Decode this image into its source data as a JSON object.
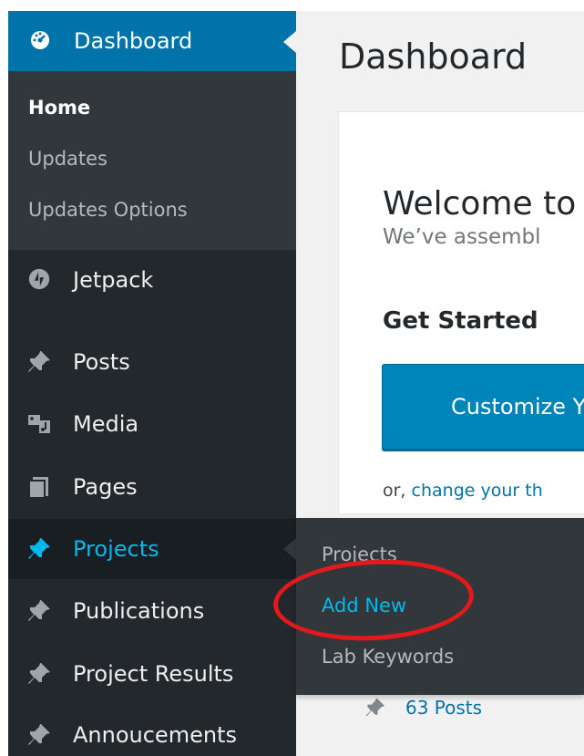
{
  "sidebar": {
    "dashboard": {
      "label": "Dashboard",
      "icon": "dashboard-gauge-icon"
    },
    "dashboard_submenu": [
      {
        "label": "Home",
        "current": true
      },
      {
        "label": "Updates",
        "current": false
      },
      {
        "label": "Updates Options",
        "current": false
      }
    ],
    "items": [
      {
        "label": "Jetpack",
        "icon": "jetpack-icon"
      },
      {
        "label": "Posts",
        "icon": "pushpin-icon"
      },
      {
        "label": "Media",
        "icon": "media-icon"
      },
      {
        "label": "Pages",
        "icon": "pages-icon"
      },
      {
        "label": "Projects",
        "icon": "pushpin-icon",
        "active": true
      },
      {
        "label": "Publications",
        "icon": "pushpin-icon"
      },
      {
        "label": "Project Results",
        "icon": "pushpin-icon"
      },
      {
        "label": "Annoucements",
        "icon": "pushpin-icon"
      }
    ]
  },
  "flyout": {
    "items": [
      {
        "label": "Projects"
      },
      {
        "label": "Add New",
        "hover": true
      },
      {
        "label": "Lab Keywords"
      }
    ]
  },
  "main": {
    "page_title": "Dashboard",
    "welcome": {
      "title": "Welcome to",
      "subtitle": "We’ve assembl",
      "get_started": "Get Started",
      "customize_button": "Customize Y",
      "or_text": "or, ",
      "change_link": "change your th"
    },
    "posts_count": "63 Posts"
  },
  "colors": {
    "menu_bg": "#23282d",
    "submenu_bg": "#32373c",
    "accent": "#0073aa",
    "active_text": "#00b9eb",
    "annotation": "#e3191c"
  }
}
